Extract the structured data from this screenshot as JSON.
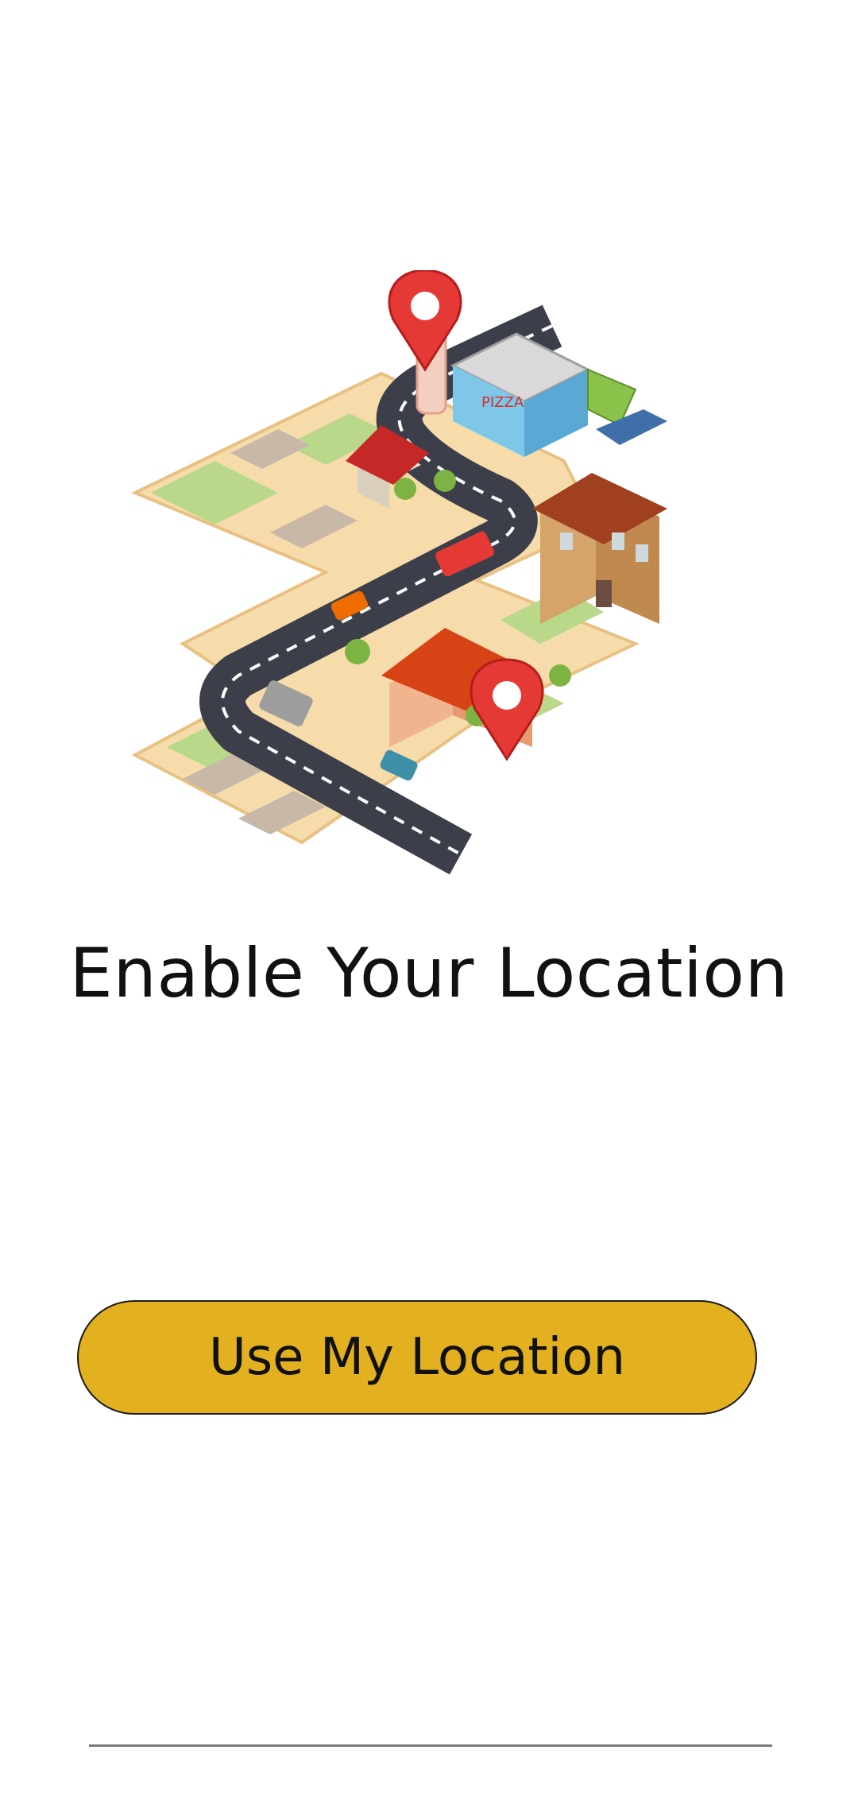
{
  "screen": {
    "title": "Enable Your Location"
  },
  "illustration": {
    "icon": "isometric-city-map-illustration",
    "sign_text": "PIZZA"
  },
  "action": {
    "label": "Use My Location"
  },
  "colors": {
    "button": "#e3b11f",
    "button_border": "#1a1a1a",
    "pin": "#e53935",
    "road": "#3c3f4a",
    "map_base": "#f7dcab",
    "grass": "#b9d88a"
  }
}
